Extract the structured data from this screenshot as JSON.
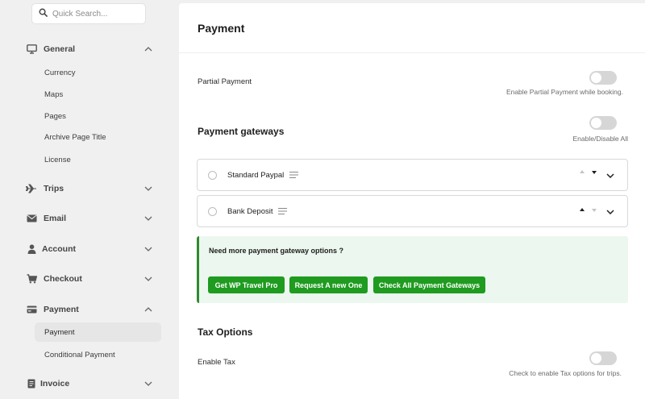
{
  "search": {
    "placeholder": "Quick Search..."
  },
  "sidebar": {
    "groups": [
      {
        "label": "General",
        "icon": "monitor-icon",
        "expanded": true
      },
      {
        "label": "Trips",
        "icon": "plane-icon",
        "expanded": false
      },
      {
        "label": "Email",
        "icon": "envelope-icon",
        "expanded": false
      },
      {
        "label": "Account",
        "icon": "user-icon",
        "expanded": false
      },
      {
        "label": "Checkout",
        "icon": "cart-icon",
        "expanded": false
      },
      {
        "label": "Payment",
        "icon": "credit-card-icon",
        "expanded": true
      },
      {
        "label": "Invoice",
        "icon": "invoice-icon",
        "expanded": false
      }
    ],
    "general_items": [
      "Currency",
      "Maps",
      "Pages",
      "Archive Page Title",
      "License"
    ],
    "payment_items": [
      "Payment",
      "Conditional Payment"
    ],
    "active_item": "Payment"
  },
  "main": {
    "title": "Payment",
    "partial_payment": {
      "label": "Partial Payment",
      "help": "Enable Partial Payment while booking.",
      "enabled": false
    },
    "gateways": {
      "title": "Payment gateways",
      "toggle_help": "Enable/Disable All",
      "enabled": false,
      "items": [
        {
          "name": "Standard Paypal"
        },
        {
          "name": "Bank Deposit"
        }
      ]
    },
    "notice": {
      "text": "Need more payment gateway options ?",
      "buttons": [
        "Get WP Travel Pro",
        "Request A new One",
        "Check All Payment Gateways"
      ]
    },
    "tax": {
      "title": "Tax Options",
      "label": "Enable Tax",
      "help": "Check to enable Tax options for trips.",
      "enabled": false
    }
  },
  "colors": {
    "accent_green": "#1f9b1f",
    "notice_bg": "#ecf7ef",
    "sidebar_bg": "#f0f0f1"
  }
}
